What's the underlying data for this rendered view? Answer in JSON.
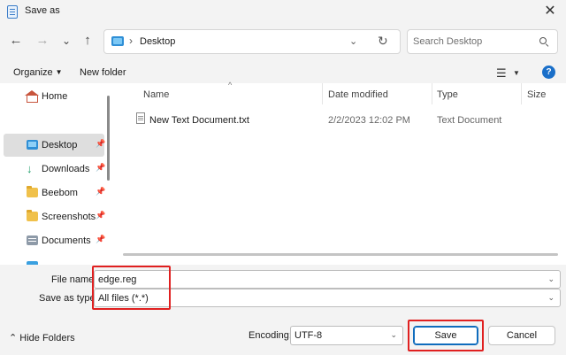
{
  "window": {
    "title": "Save as"
  },
  "nav": {
    "back": "←",
    "forward": "→",
    "recent": "⌄",
    "up": "↑",
    "address": "Desktop",
    "search_placeholder": "Search Desktop"
  },
  "toolbar": {
    "organize": "Organize",
    "new_folder": "New folder"
  },
  "sidebar": {
    "items": [
      {
        "label": "Home",
        "icon": "home-icon",
        "pinned": false
      },
      {
        "label": "Desktop",
        "icon": "desktop-folder-icon",
        "pinned": true,
        "selected": true
      },
      {
        "label": "Downloads",
        "icon": "downloads-icon",
        "pinned": true
      },
      {
        "label": "Beebom",
        "icon": "folder-icon",
        "pinned": true
      },
      {
        "label": "Screenshots",
        "icon": "folder-icon",
        "pinned": true
      },
      {
        "label": "Documents",
        "icon": "documents-icon",
        "pinned": true
      }
    ]
  },
  "columns": {
    "name": "Name",
    "date": "Date modified",
    "type": "Type",
    "size": "Size"
  },
  "files": [
    {
      "name": "New Text Document.txt",
      "date": "2/2/2023 12:02 PM",
      "type": "Text Document",
      "size": ""
    }
  ],
  "form": {
    "file_name_label": "File name:",
    "file_name_value": "edge.reg",
    "save_type_label": "Save as type:",
    "save_type_value": "All files  (*.*)"
  },
  "footer": {
    "hide_folders": "Hide Folders",
    "encoding_label": "Encoding:",
    "encoding_value": "UTF-8",
    "save": "Save",
    "cancel": "Cancel"
  },
  "colors": {
    "accent": "#0f6cbd",
    "highlight": "#e02020",
    "selected": "#dedede"
  }
}
